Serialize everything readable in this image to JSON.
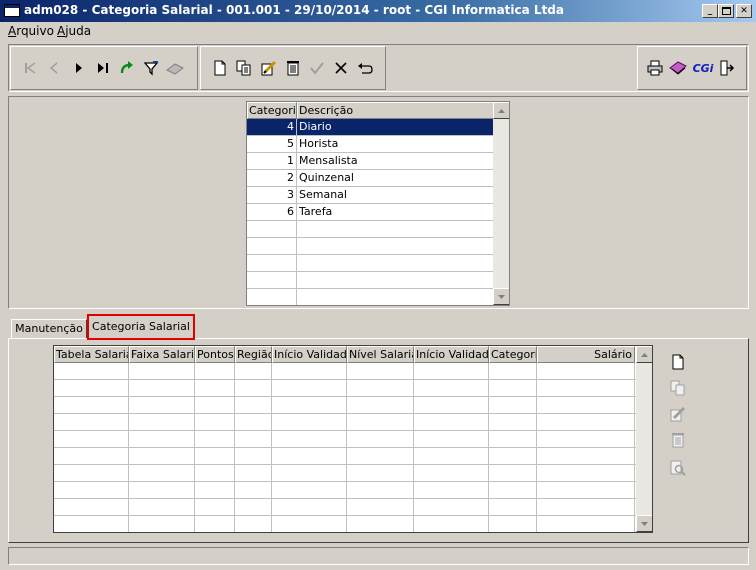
{
  "window": {
    "title": "adm028 - Categoria Salarial - 001.001 - 29/10/2014 - root - CGI Informatica Ltda",
    "minimize_icon": "minimize-icon",
    "maximize_icon": "maximize-icon",
    "close_icon": "close-icon"
  },
  "menu": {
    "items": [
      {
        "label": "Arquivo"
      },
      {
        "label": "Ajuda"
      }
    ]
  },
  "toolbar": {
    "nav_icons": [
      "first-record-icon",
      "previous-record-icon",
      "next-record-icon",
      "last-record-icon",
      "refresh-icon",
      "filter-icon",
      "clear-filter-icon"
    ],
    "edit_icons": [
      "new-record-icon",
      "copy-record-icon",
      "edit-record-icon",
      "delete-record-icon",
      "confirm-icon",
      "cancel-icon",
      "undo-icon"
    ],
    "right_icons": [
      "print-icon",
      "help-book-icon",
      "cgi-logo-icon",
      "exit-icon"
    ],
    "cgi_label": "CGi"
  },
  "category_grid": {
    "columns": [
      "Categoria",
      "Descrição"
    ],
    "rows": [
      {
        "code": "4",
        "description": "Diario",
        "selected": true
      },
      {
        "code": "5",
        "description": "Horista"
      },
      {
        "code": "1",
        "description": "Mensalista"
      },
      {
        "code": "2",
        "description": "Quinzenal"
      },
      {
        "code": "3",
        "description": "Semanal"
      },
      {
        "code": "6",
        "description": "Tarefa"
      }
    ],
    "selection_color": "#0a246a"
  },
  "tabs": [
    {
      "label": "Manutenção",
      "active": false
    },
    {
      "label": "Categoria Salarial",
      "active": true,
      "highlight_color": "#e00000"
    }
  ],
  "salary_grid": {
    "columns": [
      "Tabela Salarial",
      "Faixa Salarial",
      "Pontos",
      "Região",
      "Início Validade",
      "Nível Salarial",
      "Início Validade",
      "Categoria",
      "Salário"
    ],
    "rows": []
  },
  "side_actions": [
    "new-icon",
    "copy-icon",
    "edit-icon",
    "delete-icon",
    "search-icon"
  ],
  "status_bar": {
    "text": ""
  }
}
